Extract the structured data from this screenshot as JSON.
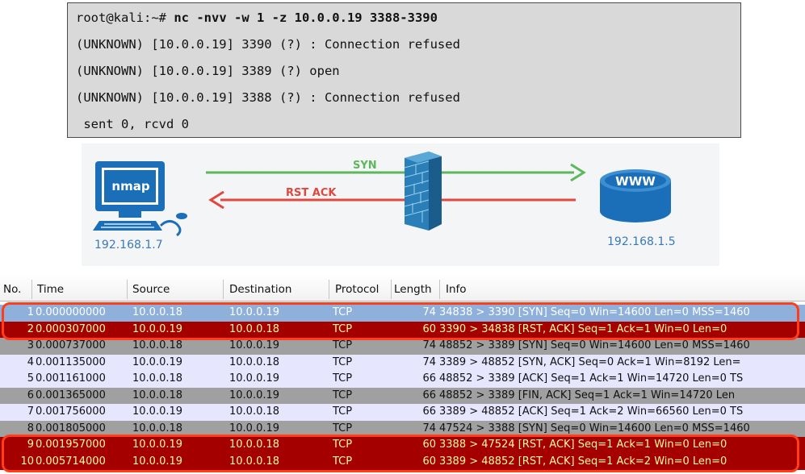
{
  "terminal": {
    "prompt": "root@kali:~# ",
    "command": "nc -nvv -w 1 -z 10.0.0.19 3388-3390",
    "lines": [
      "(UNKNOWN) [10.0.0.19] 3390 (?) : Connection refused",
      "(UNKNOWN) [10.0.0.19] 3389 (?) open",
      "(UNKNOWN) [10.0.0.19] 3388 (?) : Connection refused",
      " sent 0, rcvd 0"
    ]
  },
  "diagram": {
    "client_label": "nmap",
    "client_ip": "192.168.1.7",
    "server_label": "WWW",
    "server_ip": "192.168.1.5",
    "syn_label": "SYN",
    "rst_label": "RST ACK",
    "colors": {
      "syn": "#5cb85c",
      "rst": "#e0473f",
      "ip": "#3a79b8",
      "accent": "#1a6fb8"
    }
  },
  "packet_list": {
    "headers": [
      "No.",
      "Time",
      "Source",
      "Destination",
      "Protocol",
      "Length",
      "Info"
    ],
    "rows": [
      {
        "no": "1",
        "time": "0.000000000",
        "src": "10.0.0.18",
        "dst": "10.0.0.19",
        "proto": "TCP",
        "len": "74",
        "info": "34838 > 3390 [SYN] Seq=0 Win=14600 Len=0 MSS=1460",
        "style": "selected",
        "highlight": true
      },
      {
        "no": "2",
        "time": "0.000307000",
        "src": "10.0.0.19",
        "dst": "10.0.0.18",
        "proto": "TCP",
        "len": "60",
        "info": "3390 > 34838 [RST, ACK] Seq=1 Ack=1 Win=0 Len=0",
        "style": "rst",
        "highlight": true
      },
      {
        "no": "3",
        "time": "0.000737000",
        "src": "10.0.0.18",
        "dst": "10.0.0.19",
        "proto": "TCP",
        "len": "74",
        "info": "48852 > 3389 [SYN] Seq=0 Win=14600 Len=0 MSS=1460",
        "style": "gray",
        "highlight": false
      },
      {
        "no": "4",
        "time": "0.001135000",
        "src": "10.0.0.19",
        "dst": "10.0.0.18",
        "proto": "TCP",
        "len": "74",
        "info": "3389 > 48852 [SYN, ACK] Seq=0 Ack=1 Win=8192 Len=",
        "style": "lavender",
        "highlight": false
      },
      {
        "no": "5",
        "time": "0.001161000",
        "src": "10.0.0.18",
        "dst": "10.0.0.19",
        "proto": "TCP",
        "len": "66",
        "info": "48852 > 3389 [ACK] Seq=1 Ack=1 Win=14720 Len=0 TS",
        "style": "lavender",
        "highlight": false
      },
      {
        "no": "6",
        "time": "0.001365000",
        "src": "10.0.0.18",
        "dst": "10.0.0.19",
        "proto": "TCP",
        "len": "66",
        "info": "48852 > 3389 [FIN, ACK] Seq=1 Ack=1 Win=14720 Len",
        "style": "gray",
        "highlight": false
      },
      {
        "no": "7",
        "time": "0.001756000",
        "src": "10.0.0.19",
        "dst": "10.0.0.18",
        "proto": "TCP",
        "len": "66",
        "info": "3389 > 48852 [ACK] Seq=1 Ack=2 Win=66560 Len=0 TS",
        "style": "lavender",
        "highlight": false
      },
      {
        "no": "8",
        "time": "0.001805000",
        "src": "10.0.0.18",
        "dst": "10.0.0.19",
        "proto": "TCP",
        "len": "74",
        "info": "47524 > 3388 [SYN] Seq=0 Win=14600 Len=0 MSS=1460",
        "style": "gray",
        "highlight": false
      },
      {
        "no": "9",
        "time": "0.001957000",
        "src": "10.0.0.19",
        "dst": "10.0.0.18",
        "proto": "TCP",
        "len": "60",
        "info": "3388 > 47524 [RST, ACK] Seq=1 Ack=1 Win=0 Len=0",
        "style": "rst",
        "highlight": true
      },
      {
        "no": "10",
        "time": "0.005714000",
        "src": "10.0.0.19",
        "dst": "10.0.0.18",
        "proto": "TCP",
        "len": "60",
        "info": "3389 > 48852 [RST, ACK] Seq=1 Ack=2 Win=0 Len=0",
        "style": "rst",
        "highlight": true
      }
    ],
    "row_colors": {
      "selected": {
        "bg": "#8fb0db",
        "fg": "#ffffff"
      },
      "rst": {
        "bg": "#a40000",
        "fg": "#fffc9c"
      },
      "gray": {
        "bg": "#a0a0a0",
        "fg": "#111111"
      },
      "lavender": {
        "bg": "#e7e6ff",
        "fg": "#111111"
      }
    },
    "highlight_color": "#ff3d1a"
  }
}
